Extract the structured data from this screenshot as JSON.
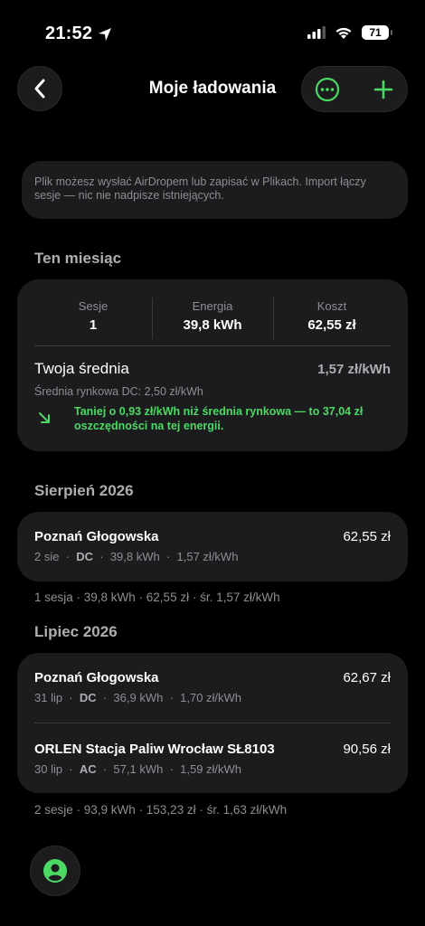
{
  "status_bar": {
    "time": "21:52",
    "battery": "71"
  },
  "header": {
    "title": "Moje ładowania"
  },
  "info": {
    "text": "Plik możesz wysłać AirDropem lub zapisać w Plikach. Import łączy sesje — nic nie nadpisze istniejących."
  },
  "this_month": {
    "heading": "Ten miesiąc",
    "sessions_label": "Sesje",
    "sessions_value": "1",
    "energy_label": "Energia",
    "energy_value": "39,8 kWh",
    "cost_label": "Koszt",
    "cost_value": "62,55 zł",
    "avg_label": "Twoja średnia",
    "avg_value": "1,57 zł/kWh",
    "market_avg": "Średnia rynkowa DC: 2,50 zł/kWh",
    "saving_text": "Taniej o 0,93 zł/kWh niż średnia rynkowa — to 37,04 zł oszczędności na tej energii."
  },
  "august": {
    "heading": "Sierpień 2026",
    "sessions": [
      {
        "name": "Poznań Głogowska",
        "price": "62,55 zł",
        "date": "2 sie",
        "type": "DC",
        "energy": "39,8 kWh",
        "rate": "1,57 zł/kWh"
      }
    ],
    "summary": "1 sesja · 39,8 kWh · 62,55 zł · śr. 1,57 zł/kWh"
  },
  "july": {
    "heading": "Lipiec 2026",
    "sessions": [
      {
        "name": "Poznań Głogowska",
        "price": "62,67 zł",
        "date": "31 lip",
        "type": "DC",
        "energy": "36,9 kWh",
        "rate": "1,70 zł/kWh"
      },
      {
        "name": "ORLEN Stacja Paliw Wrocław SŁ8103",
        "price": "90,56 zł",
        "date": "30 lip",
        "type": "AC",
        "energy": "57,1 kWh",
        "rate": "1,59 zł/kWh"
      }
    ],
    "summary": "2 sesje · 93,9 kWh · 153,23 zł · śr. 1,63 zł/kWh"
  },
  "colors": {
    "accent": "#4cd964",
    "card": "#1c1c1e",
    "muted": "#8e8e93"
  },
  "icons": [
    "location-arrow-icon",
    "signal-icon",
    "wifi-icon",
    "battery-icon",
    "back-chevron-icon",
    "more-icon",
    "add-icon",
    "savings-arrow-icon",
    "profile-icon"
  ]
}
